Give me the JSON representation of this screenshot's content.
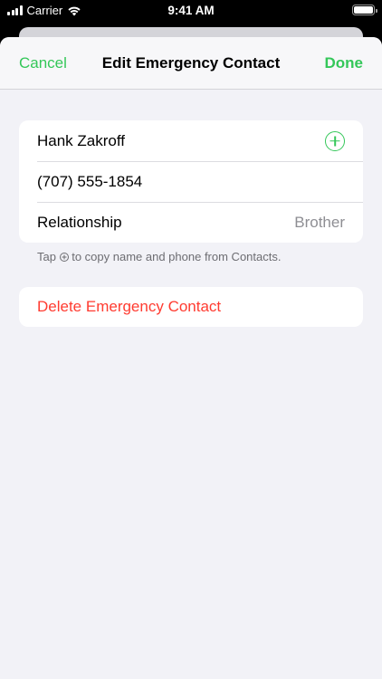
{
  "status_bar": {
    "carrier": "Carrier",
    "time": "9:41 AM"
  },
  "nav": {
    "cancel_label": "Cancel",
    "title": "Edit Emergency Contact",
    "done_label": "Done"
  },
  "contact": {
    "name": "Hank Zakroff",
    "phone": "(707) 555-1854",
    "relationship_label": "Relationship",
    "relationship_value": "Brother"
  },
  "footer": {
    "prefix": "Tap",
    "suffix": "to copy name and phone from Contacts."
  },
  "delete_label": "Delete Emergency Contact",
  "icons": {
    "add_contact": "plus-circle-icon",
    "footer_icon": "plus-circle-icon",
    "signal": "cellular-signal-icon",
    "wifi": "wifi-icon",
    "battery": "battery-icon"
  },
  "colors": {
    "accent": "#34c759",
    "destructive": "#ff3b30",
    "secondary_text": "#8e8e93",
    "background": "#f2f2f7"
  }
}
